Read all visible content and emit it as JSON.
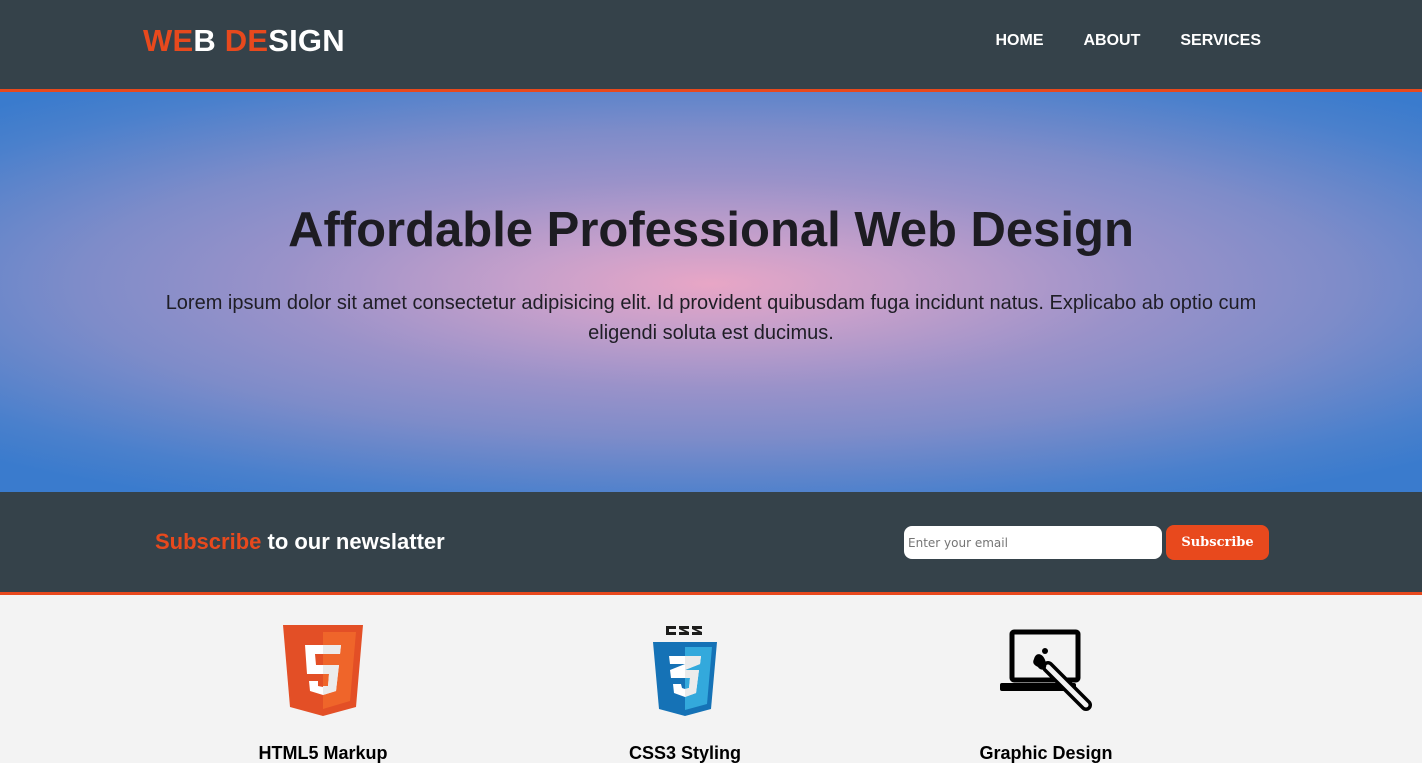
{
  "header": {
    "logo_part1": "WE",
    "logo_part2": "B ",
    "logo_part3": "DE",
    "logo_part4": "SIGN",
    "nav": [
      {
        "label": "HOME"
      },
      {
        "label": "ABOUT"
      },
      {
        "label": "SERVICES"
      }
    ]
  },
  "showcase": {
    "title": "Affordable Professional Web Design",
    "text": "Lorem ipsum dolor sit amet consectetur adipisicing elit. Id provident quibusdam fuga incidunt natus. Explicabo ab optio cum eligendi soluta est ducimus."
  },
  "newsletter": {
    "heading_highlight": "Subscribe",
    "heading_rest": " to our newslatter",
    "email_placeholder": "Enter your email",
    "button_label": "Subscribe"
  },
  "boxes": [
    {
      "title": "HTML5 Markup",
      "icon": "html5-logo-icon"
    },
    {
      "title": "CSS3 Styling",
      "icon": "css3-logo-icon"
    },
    {
      "title": "Graphic Design",
      "icon": "laptop-brush-icon"
    }
  ],
  "colors": {
    "accent": "#e8491d",
    "dark": "#35424a",
    "light_bg": "#f3f3f3"
  }
}
